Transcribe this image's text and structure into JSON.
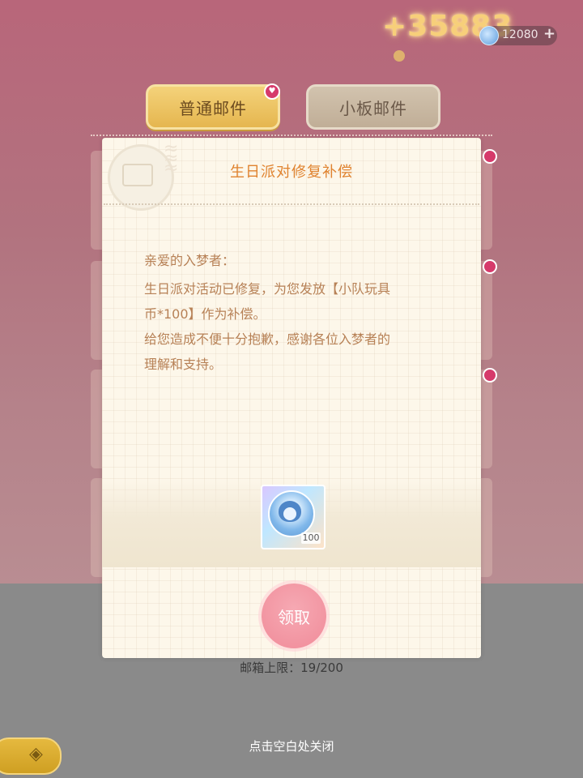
{
  "currency": {
    "gain_text": "+35883",
    "balance": "12080",
    "plus": "+"
  },
  "tabs": [
    {
      "label": "普通邮件",
      "active": true
    },
    {
      "label": "小板邮件",
      "active": false
    }
  ],
  "mailbox": {
    "limit_text": "邮箱上限：19/200"
  },
  "modal": {
    "title": "生日派对修复补偿",
    "greeting": "亲爱的入梦者：",
    "line1": "生日派对活动已修复，为您发放【小队玩具",
    "line2": "币*100】作为补偿。",
    "line3": "给您造成不便十分抱歉，感谢各位入梦者的",
    "line4": "理解和支持。",
    "reward": {
      "icon": "toy-coin-icon",
      "quantity": "100"
    },
    "claim_label": "领取"
  },
  "close_hint": "点击空白处关闭",
  "colors": {
    "title": "#e0832f",
    "body_text": "#b78156",
    "claim_button": "#f08b99",
    "tab_active": "#e5b64f"
  }
}
